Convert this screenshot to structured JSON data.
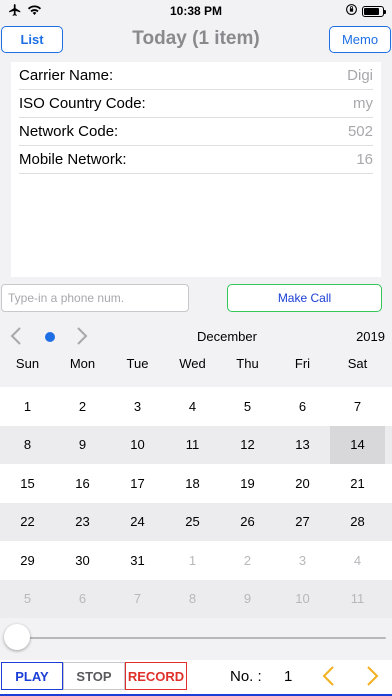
{
  "status_bar": {
    "time": "10:38 PM",
    "battery_level": 0.85,
    "icons": [
      "airplane-icon",
      "wifi-icon",
      "orientation-lock-icon",
      "battery-icon"
    ]
  },
  "nav": {
    "title": "Today (1 item)",
    "left_button": "List",
    "right_button": "Memo"
  },
  "carrier_info": [
    {
      "label": "Carrier Name:",
      "value": "Digi"
    },
    {
      "label": "ISO Country Code:",
      "value": "my"
    },
    {
      "label": "Network Code:",
      "value": "502"
    },
    {
      "label": "Mobile Network:",
      "value": "16"
    }
  ],
  "phone": {
    "placeholder": "Type-in a phone num.",
    "value": "",
    "call_button": "Make Call"
  },
  "calendar": {
    "month": "December",
    "year": "2019",
    "weekdays": [
      "Sun",
      "Mon",
      "Tue",
      "Wed",
      "Thu",
      "Fri",
      "Sat"
    ],
    "selected_day": "14",
    "weeks": [
      [
        {
          "d": "1",
          "cur": true
        },
        {
          "d": "2",
          "cur": true
        },
        {
          "d": "3",
          "cur": true
        },
        {
          "d": "4",
          "cur": true
        },
        {
          "d": "5",
          "cur": true
        },
        {
          "d": "6",
          "cur": true
        },
        {
          "d": "7",
          "cur": true
        }
      ],
      [
        {
          "d": "8",
          "cur": true
        },
        {
          "d": "9",
          "cur": true
        },
        {
          "d": "10",
          "cur": true
        },
        {
          "d": "11",
          "cur": true
        },
        {
          "d": "12",
          "cur": true
        },
        {
          "d": "13",
          "cur": true
        },
        {
          "d": "14",
          "cur": true
        }
      ],
      [
        {
          "d": "15",
          "cur": true
        },
        {
          "d": "16",
          "cur": true
        },
        {
          "d": "17",
          "cur": true
        },
        {
          "d": "18",
          "cur": true
        },
        {
          "d": "19",
          "cur": true
        },
        {
          "d": "20",
          "cur": true
        },
        {
          "d": "21",
          "cur": true
        }
      ],
      [
        {
          "d": "22",
          "cur": true
        },
        {
          "d": "23",
          "cur": true
        },
        {
          "d": "24",
          "cur": true
        },
        {
          "d": "25",
          "cur": true
        },
        {
          "d": "26",
          "cur": true
        },
        {
          "d": "27",
          "cur": true
        },
        {
          "d": "28",
          "cur": true
        }
      ],
      [
        {
          "d": "29",
          "cur": true
        },
        {
          "d": "30",
          "cur": true
        },
        {
          "d": "31",
          "cur": true
        },
        {
          "d": "1",
          "cur": false
        },
        {
          "d": "2",
          "cur": false
        },
        {
          "d": "3",
          "cur": false
        },
        {
          "d": "4",
          "cur": false
        }
      ],
      [
        {
          "d": "5",
          "cur": false
        },
        {
          "d": "6",
          "cur": false
        },
        {
          "d": "7",
          "cur": false
        },
        {
          "d": "8",
          "cur": false
        },
        {
          "d": "9",
          "cur": false
        },
        {
          "d": "10",
          "cur": false
        },
        {
          "d": "11",
          "cur": false
        }
      ]
    ]
  },
  "playback": {
    "slider_value": 0.0,
    "play": "PLAY",
    "stop": "STOP",
    "record": "RECORD",
    "no_label": "No. :",
    "no_value": "1"
  },
  "colors": {
    "accent_blue": "#1e6fe6",
    "call_border_green": "#34c759",
    "record_red": "#e0302a",
    "nav_arrow_yellow": "#f2b01e"
  }
}
